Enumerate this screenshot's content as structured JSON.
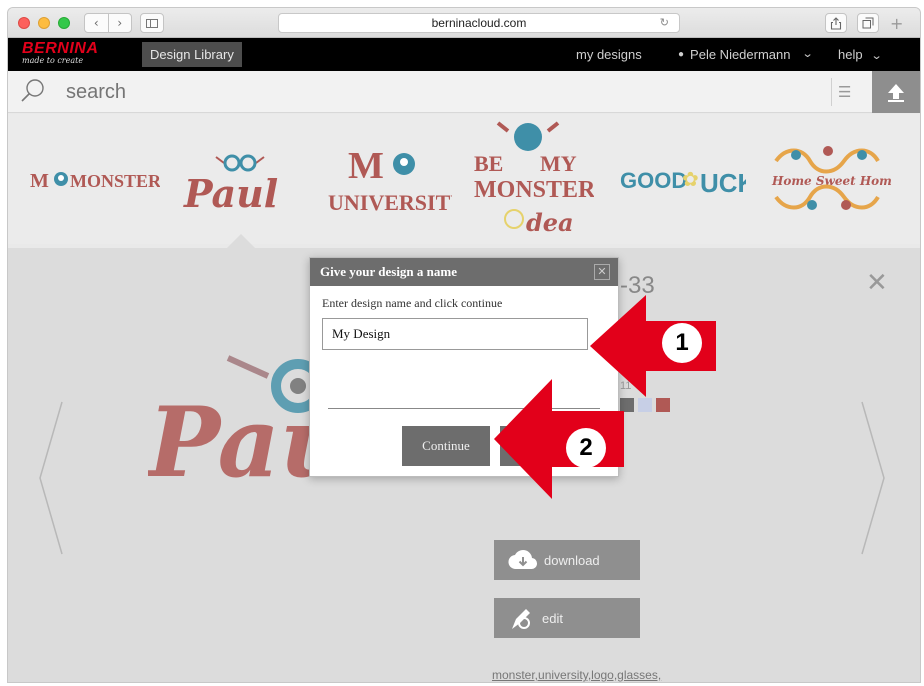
{
  "browser": {
    "url": "berninacloud.com",
    "nav_back": "‹",
    "nav_forward": "›"
  },
  "header": {
    "logo": "BERNINA",
    "logo_tagline": "made to create",
    "active_tab": "Design Library",
    "my_designs": "my designs",
    "user_name": "Pele Niedermann",
    "help": "help"
  },
  "search": {
    "placeholder": "search"
  },
  "carousel": {
    "items": [
      {
        "label": "M MONSTER",
        "color": "#b05955"
      },
      {
        "label": "Paul",
        "color": "#b05955"
      },
      {
        "label": "M UNIVERSITY",
        "color": "#b05955"
      },
      {
        "label": "BE MY MONSTER idea",
        "color": "#b05955"
      },
      {
        "label": "GOOD LUCK",
        "color": "#3f8fa8"
      },
      {
        "label": "Home Sweet Home",
        "color": "#b05955"
      }
    ]
  },
  "detail": {
    "title_fragment": "-33",
    "color_count_fragment": "11",
    "swatches": [
      "#6d6d6d",
      "#c7cfe6",
      "#b05955"
    ],
    "download_label": "download",
    "edit_label": "edit",
    "tags": "monster,university,logo,glasses,"
  },
  "dialog": {
    "title": "Give your design a name",
    "prompt": "Enter design name and click continue",
    "input_value": "My Design",
    "continue_label": "Continue"
  },
  "annotations": {
    "step1": "1",
    "step2": "2",
    "arrow_color": "#e2001a"
  }
}
